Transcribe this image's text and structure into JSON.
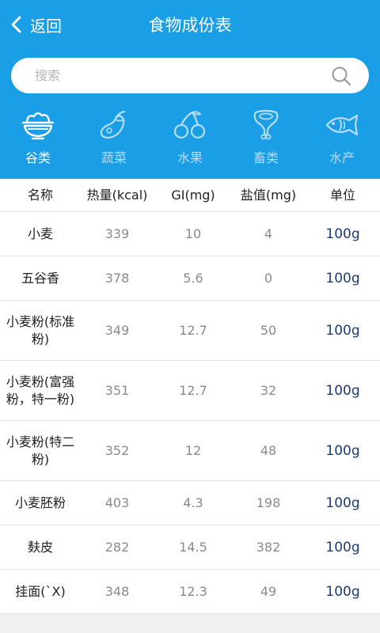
{
  "header": {
    "back_label": "返回",
    "title": "食物成份表",
    "accent_color": "#1a9ee5"
  },
  "search": {
    "placeholder": "搜索",
    "value": ""
  },
  "categories": [
    {
      "label": "谷类",
      "icon": "rice-bowl-icon",
      "active": true
    },
    {
      "label": "蔬菜",
      "icon": "eggplant-icon",
      "active": false
    },
    {
      "label": "水果",
      "icon": "cherry-icon",
      "active": false
    },
    {
      "label": "畜类",
      "icon": "ham-leg-icon",
      "active": false
    },
    {
      "label": "水产",
      "icon": "fish-icon",
      "active": false
    }
  ],
  "table": {
    "columns": [
      "名称",
      "热量(kcal)",
      "GI(mg)",
      "盐值(mg)",
      "单位"
    ],
    "rows": [
      {
        "name": "小麦",
        "calories": "339",
        "gi": "10",
        "salt": "4",
        "unit": "100g"
      },
      {
        "name": "五谷香",
        "calories": "378",
        "gi": "5.6",
        "salt": "0",
        "unit": "100g"
      },
      {
        "name": "小麦粉(标准粉)",
        "calories": "349",
        "gi": "12.7",
        "salt": "50",
        "unit": "100g"
      },
      {
        "name": "小麦粉(富强粉，特一粉)",
        "calories": "351",
        "gi": "12.7",
        "salt": "32",
        "unit": "100g"
      },
      {
        "name": "小麦粉(特二粉)",
        "calories": "352",
        "gi": "12",
        "salt": "48",
        "unit": "100g"
      },
      {
        "name": "小麦胚粉",
        "calories": "403",
        "gi": "4.3",
        "salt": "198",
        "unit": "100g"
      },
      {
        "name": "麸皮",
        "calories": "282",
        "gi": "14.5",
        "salt": "382",
        "unit": "100g"
      },
      {
        "name": "挂面(`X)",
        "calories": "348",
        "gi": "12.3",
        "salt": "49",
        "unit": "100g"
      }
    ]
  }
}
